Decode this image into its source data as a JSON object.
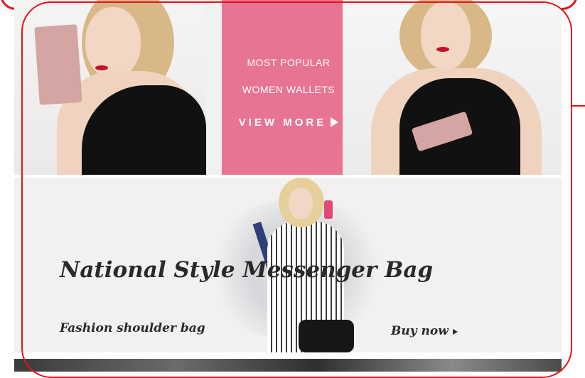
{
  "promo": {
    "line1": "MOST POPULAR",
    "line2": "WOMEN WALLETS",
    "cta_label": "VIEW MORE",
    "cta_icon": "play-icon",
    "panel_color": "#e87494"
  },
  "banner2": {
    "headline": "National Style Messenger Bag",
    "subline": "Fashion shoulder bag",
    "buy_label": "Buy now",
    "buy_icon": "small-play-icon"
  },
  "annotation": {
    "highlight_color": "#e8141b"
  }
}
